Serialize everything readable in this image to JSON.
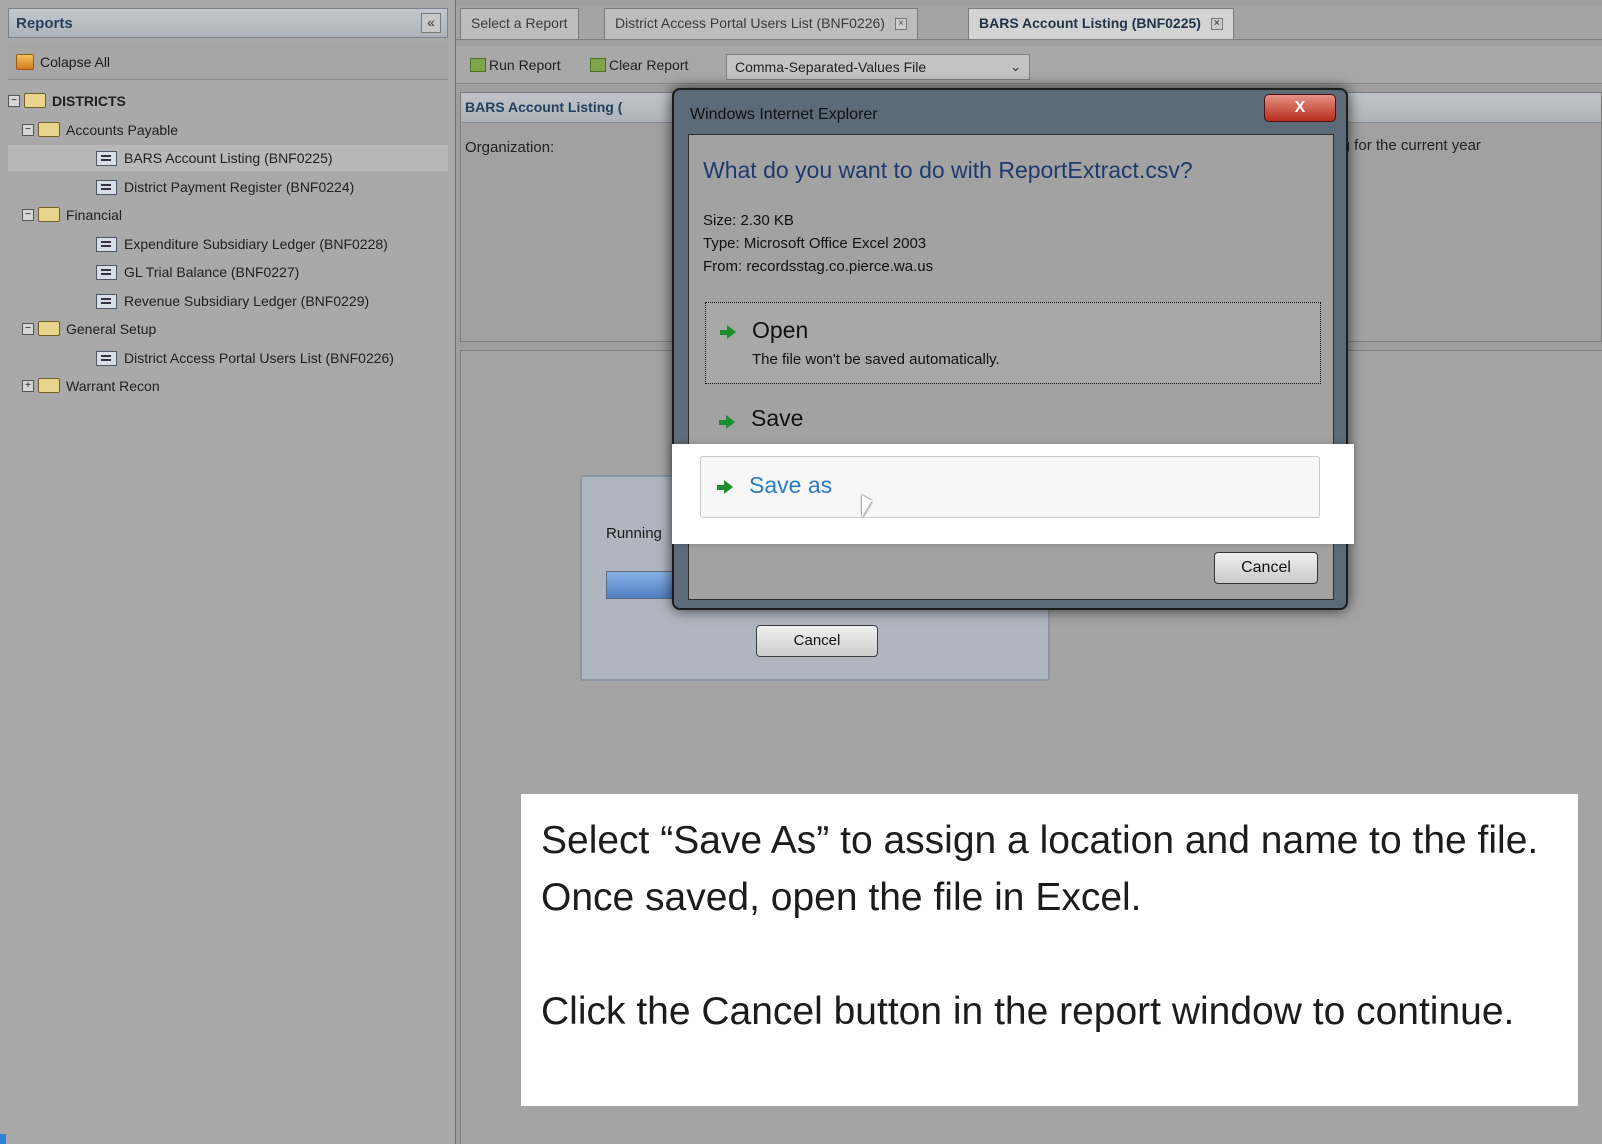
{
  "sidebar": {
    "title": "Reports",
    "collapse_symbol": "«",
    "collapse_all_label": "Colapse All",
    "tree": [
      {
        "label": "DISTRICTS",
        "level": 0,
        "kind": "folder",
        "expander": "−"
      },
      {
        "label": "Accounts Payable",
        "level": 1,
        "kind": "folder",
        "expander": "−"
      },
      {
        "label": "BARS Account Listing (BNF0225)",
        "level": 2,
        "kind": "report",
        "selected": true
      },
      {
        "label": "District Payment Register (BNF0224)",
        "level": 2,
        "kind": "report"
      },
      {
        "label": "Financial",
        "level": 1,
        "kind": "folder",
        "expander": "−"
      },
      {
        "label": "Expenditure Subsidiary Ledger (BNF0228)",
        "level": 2,
        "kind": "report"
      },
      {
        "label": "GL Trial Balance (BNF0227)",
        "level": 2,
        "kind": "report"
      },
      {
        "label": "Revenue Subsidiary Ledger (BNF0229)",
        "level": 2,
        "kind": "report"
      },
      {
        "label": "General Setup",
        "level": 1,
        "kind": "folder",
        "expander": "−"
      },
      {
        "label": "District Access Portal Users List (BNF0226)",
        "level": 2,
        "kind": "report"
      },
      {
        "label": "Warrant Recon",
        "level": 1,
        "kind": "folder",
        "expander": "+"
      }
    ]
  },
  "tabs": [
    {
      "label": "Select a Report",
      "closable": false
    },
    {
      "label": "District Access Portal Users List (BNF0226)",
      "closable": true
    },
    {
      "label": "BARS Account Listing (BNF0225)",
      "closable": true,
      "active": true
    }
  ],
  "tab_close_symbol": "×",
  "toolbar": {
    "run_label": "Run Report",
    "clear_label": "Clear Report",
    "format_value": "Comma-Separated-Values File",
    "dropdown_symbol": "⌄"
  },
  "report_panel": {
    "title": "BARS Account Listing (",
    "organization_label": "Organization:",
    "description_fragment": "isting for the current year"
  },
  "running": {
    "label": "Running",
    "progress": 0.3,
    "cancel_label": "Cancel"
  },
  "dialog": {
    "title": "Windows Internet Explorer",
    "close_symbol": "X",
    "question": "What do you want to do with ReportExtract.csv?",
    "size_line": "Size: 2.30 KB",
    "type_line": "Type: Microsoft Office Excel 2003",
    "from_line": "From: recordsstag.co.pierce.wa.us",
    "options": {
      "open_title": "Open",
      "open_sub": "The file won't be saved automatically.",
      "save_title": "Save",
      "save_as_title": "Save as"
    },
    "cancel_label": "Cancel"
  },
  "instructions": {
    "line1": "Select “Save As” to assign a location and name to the file. Once saved, open the file in Excel.",
    "line2": "Click the Cancel button in the report window to continue."
  },
  "colors": {
    "question": "#1e3a6e",
    "arrow": "#1b8f2d",
    "panel_title": "#26415d"
  }
}
